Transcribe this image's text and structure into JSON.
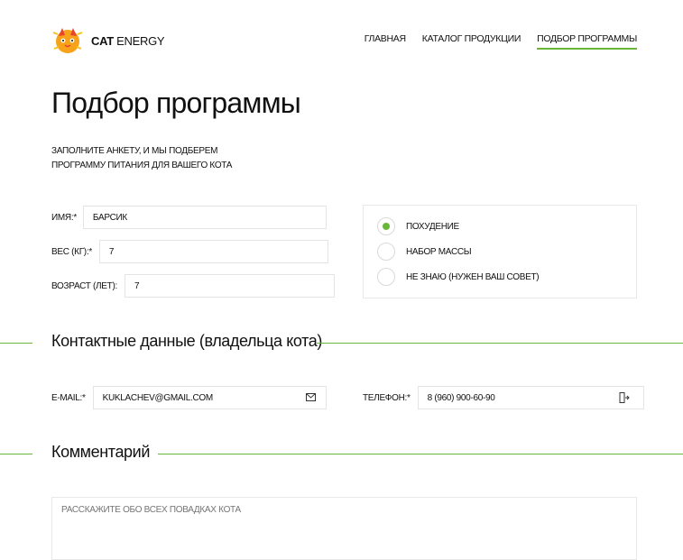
{
  "header": {
    "logo_bold": "CAT",
    "logo_light": "ENERGY",
    "nav": [
      {
        "label": "ГЛАВНАЯ",
        "active": false
      },
      {
        "label": "КАТАЛОГ ПРОДУКЦИИ",
        "active": false
      },
      {
        "label": "ПОДБОР ПРОГРАММЫ",
        "active": true
      }
    ]
  },
  "page": {
    "title": "Подбор программы",
    "intro_line1": "ЗАПОЛНИТЕ АНКЕТУ, И МЫ ПОДБЕРЕМ",
    "intro_line2": "ПРОГРАММУ ПИТАНИЯ ДЛЯ ВАШЕГО КОТА"
  },
  "form": {
    "name_label": "ИМЯ:*",
    "name_value": "БАРСИК",
    "weight_label": "ВЕС (КГ):*",
    "weight_value": "7",
    "age_label": "ВОЗРАСТ (ЛЕТ):",
    "age_value": "7",
    "goals": [
      {
        "label": "ПОХУДЕНИЕ",
        "checked": true
      },
      {
        "label": "НАБОР МАССЫ",
        "checked": false
      },
      {
        "label": "НЕ ЗНАЮ (НУЖЕН ВАШ СОВЕТ)",
        "checked": false
      }
    ],
    "contacts_title": "Контактные данные (владельца кота)",
    "email_label": "E-MAIL:*",
    "email_value": "KUKLACHEV@GMAIL.COM",
    "phone_label": "ТЕЛЕФОН:*",
    "phone_value": "8 (960) 900-60-90",
    "comment_title": "Комментарий",
    "comment_placeholder": "РАССКАЖИТЕ ОБО ВСЕХ ПОВАДКАХ КОТА"
  },
  "colors": {
    "accent": "#68b738",
    "logo_orange": "#f7a21b",
    "logo_red": "#e8432c"
  },
  "icons": {
    "email": "mail-icon",
    "phone": "phone-icon",
    "logo": "cat-energy-logo"
  }
}
